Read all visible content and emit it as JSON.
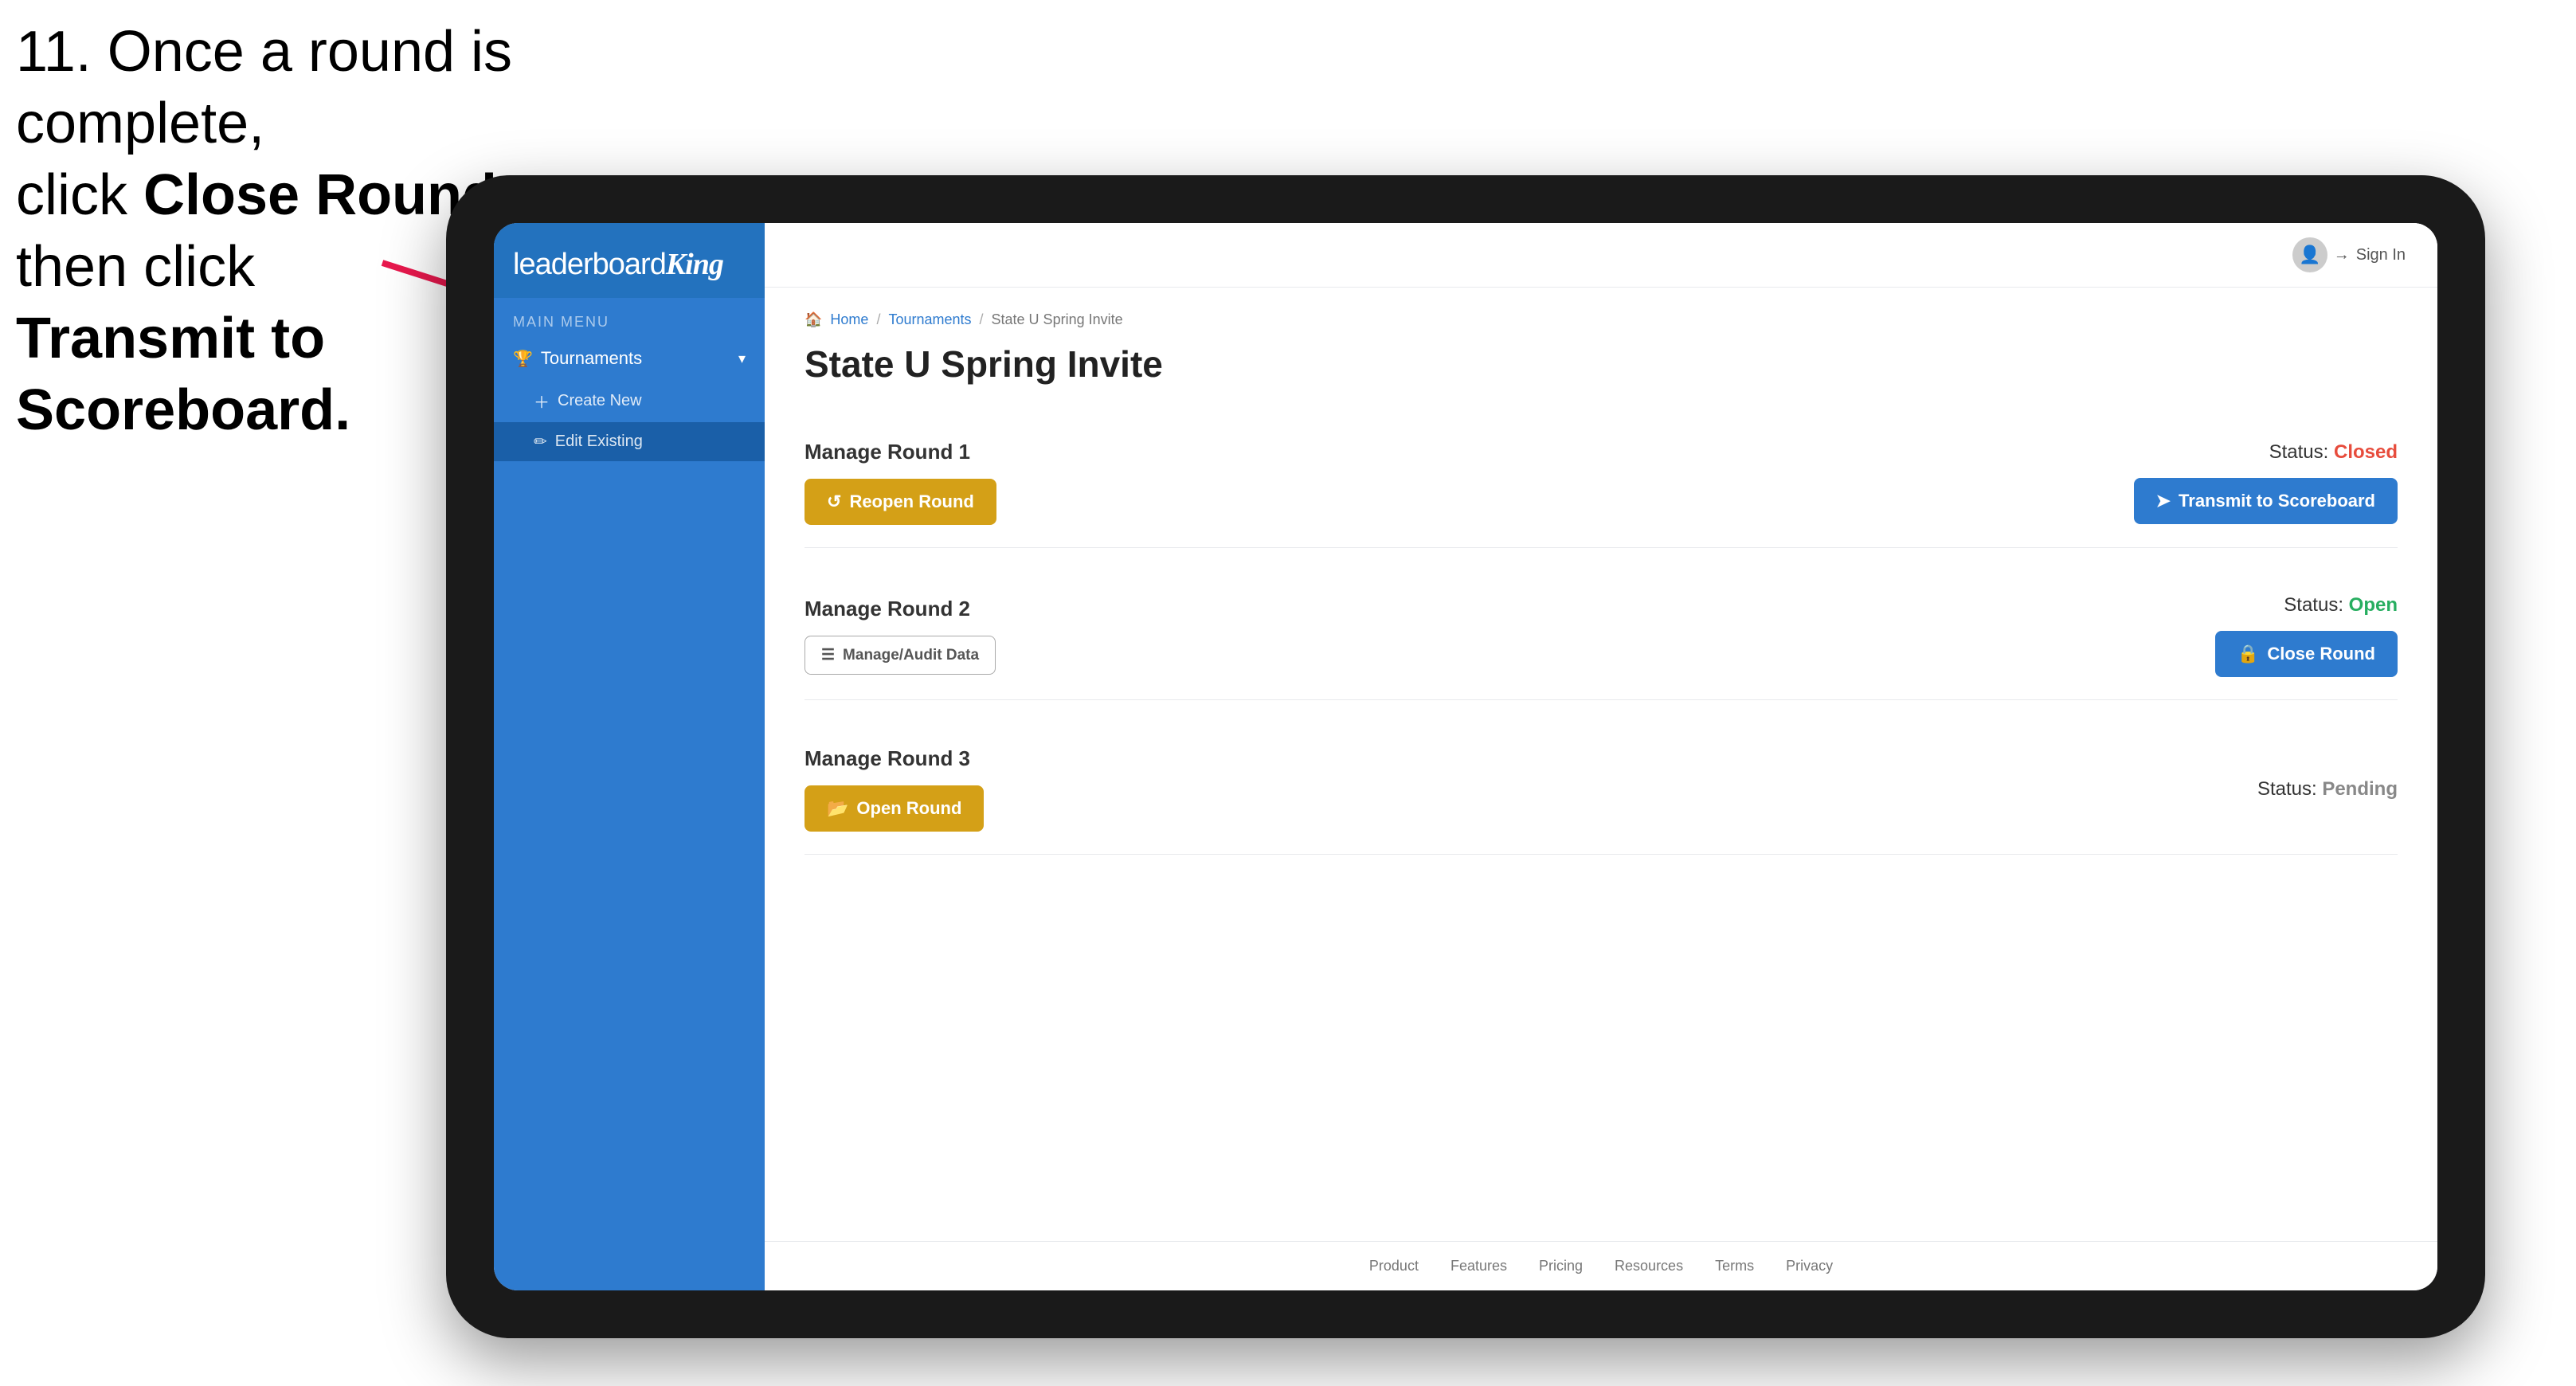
{
  "instruction": {
    "line1": "11. Once a round is complete,",
    "line2": "click ",
    "bold1": "Close Round",
    "line3": " then click",
    "bold2": "Transmit to Scoreboard."
  },
  "app": {
    "logo": {
      "leaderboard": "leaderboard",
      "king": "King"
    },
    "sidebar": {
      "menu_label": "MAIN MENU",
      "tournaments_label": "Tournaments",
      "create_new_label": "Create New",
      "edit_existing_label": "Edit Existing"
    },
    "topnav": {
      "sign_in": "Sign In"
    },
    "breadcrumb": {
      "home": "Home",
      "tournaments": "Tournaments",
      "current": "State U Spring Invite"
    },
    "page_title": "State U Spring Invite",
    "rounds": [
      {
        "id": "round1",
        "title": "Manage Round 1",
        "status_label": "Status:",
        "status_value": "Closed",
        "status_type": "closed",
        "buttons": [
          {
            "id": "reopen-round",
            "label": "Reopen Round",
            "style": "gold",
            "icon": "↺"
          },
          {
            "id": "transmit-scoreboard",
            "label": "Transmit to Scoreboard",
            "style": "blue",
            "icon": "➤"
          }
        ]
      },
      {
        "id": "round2",
        "title": "Manage Round 2",
        "status_label": "Status:",
        "status_value": "Open",
        "status_type": "open",
        "buttons": [
          {
            "id": "manage-audit",
            "label": "Manage/Audit Data",
            "style": "outline",
            "icon": "☰"
          },
          {
            "id": "close-round",
            "label": "Close Round",
            "style": "blue",
            "icon": "🔒"
          }
        ]
      },
      {
        "id": "round3",
        "title": "Manage Round 3",
        "status_label": "Status:",
        "status_value": "Pending",
        "status_type": "pending",
        "buttons": [
          {
            "id": "open-round",
            "label": "Open Round",
            "style": "gold",
            "icon": "📂"
          }
        ]
      }
    ],
    "footer": {
      "links": [
        "Product",
        "Features",
        "Pricing",
        "Resources",
        "Terms",
        "Privacy"
      ]
    }
  }
}
